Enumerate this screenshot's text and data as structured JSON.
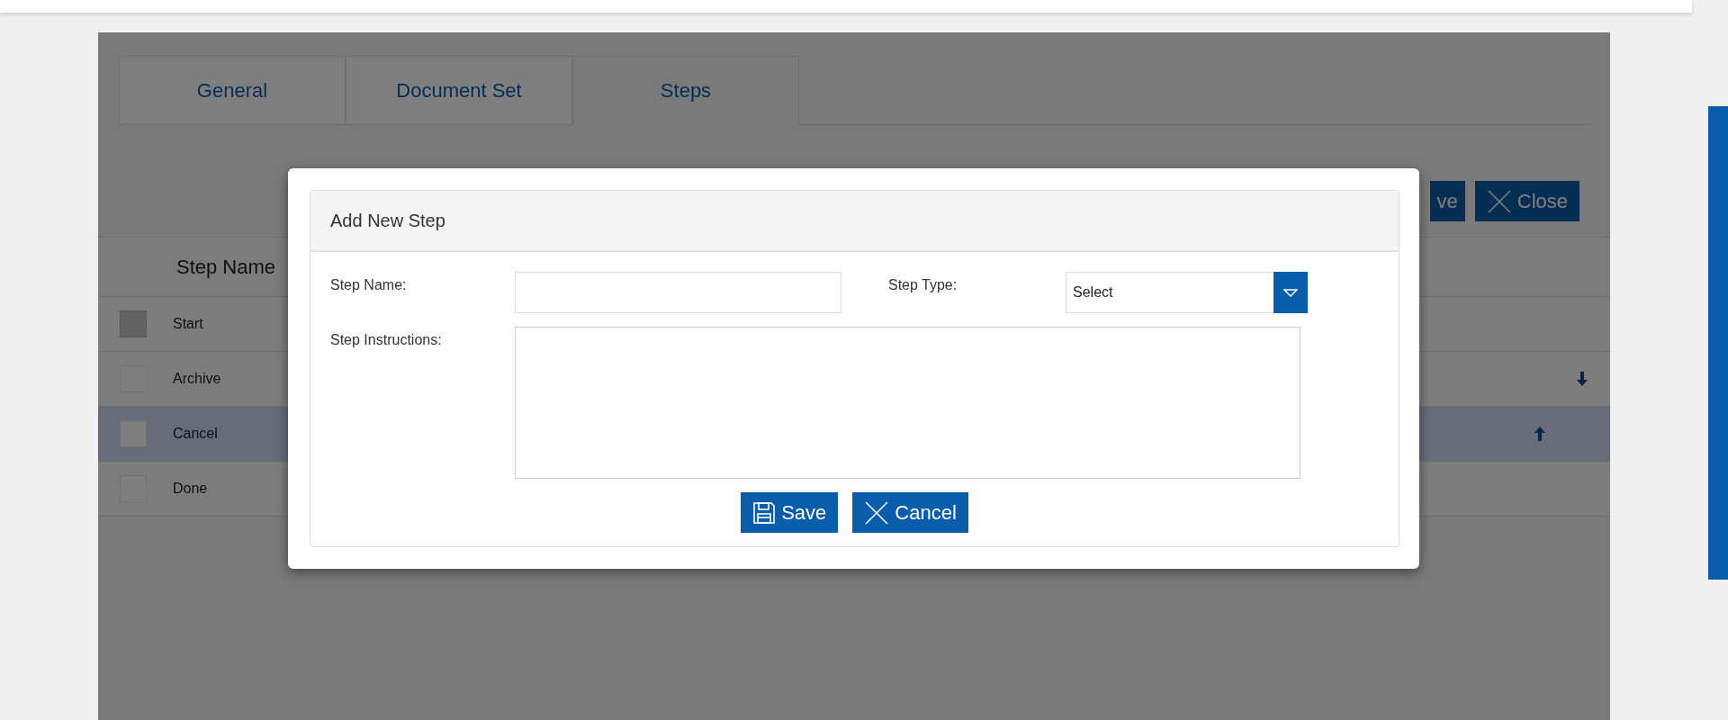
{
  "tabs": [
    {
      "label": "General",
      "selected": false
    },
    {
      "label": "Document Set",
      "selected": false
    },
    {
      "label": "Steps",
      "selected": true
    }
  ],
  "toolbar": {
    "buttons": [
      {
        "label": "ve",
        "kind": "text"
      },
      {
        "label": "Close",
        "kind": "close"
      }
    ]
  },
  "table": {
    "columns": [
      "Step Name"
    ],
    "rows": [
      {
        "name": "Start",
        "checked": false,
        "disabled": true,
        "selected": false,
        "move_up": false,
        "move_down": false
      },
      {
        "name": "Archive",
        "checked": false,
        "disabled": false,
        "selected": false,
        "move_up": false,
        "move_down": true
      },
      {
        "name": "Cancel",
        "checked": false,
        "disabled": false,
        "selected": true,
        "move_up": true,
        "move_down": false
      },
      {
        "name": "Done",
        "checked": false,
        "disabled": false,
        "selected": false,
        "move_up": false,
        "move_down": false
      }
    ]
  },
  "dialog": {
    "title": "Add New Step",
    "fields": [
      {
        "label": "Step Name:",
        "kind": "text"
      },
      {
        "label": "Step Type:",
        "kind": "select",
        "value": "Select"
      },
      {
        "label": "Step Instructions:",
        "kind": "textarea"
      }
    ],
    "buttons": [
      {
        "label": "Save",
        "kind": "save"
      },
      {
        "label": "Cancel",
        "kind": "cancel"
      }
    ]
  }
}
